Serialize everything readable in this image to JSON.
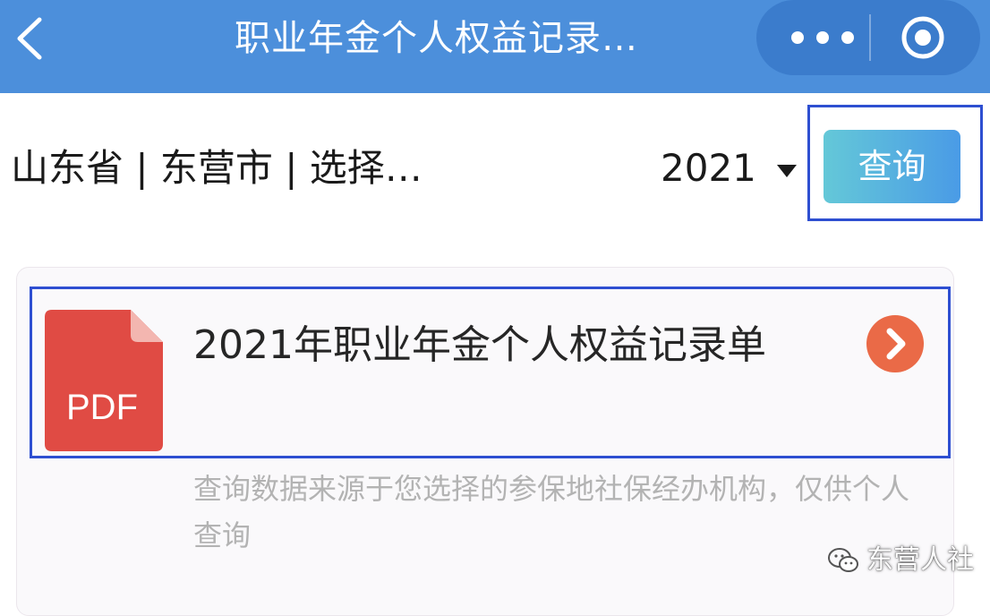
{
  "navbar": {
    "title": "职业年金个人权益记录…",
    "back_icon": "chevron-left-icon",
    "more_icon": "more-dots-icon",
    "close_icon": "target-circle-icon",
    "bg_color": "#4c8fdb"
  },
  "filter": {
    "region_label": "山东省 | 东营市 | 选择…",
    "year_value": "2021",
    "caret_icon": "caret-down-icon",
    "query_button_label": "查询",
    "query_button_colors": [
      "#64c8d8",
      "#4a9be6"
    ]
  },
  "record": {
    "pdf_badge": "PDF",
    "pdf_color": "#e04b44",
    "title": "2021年职业年金个人权益记录单",
    "chevron_icon": "chevron-right-circle-icon",
    "chevron_color": "#ea6a47",
    "note": "查询数据来源于您选择的参保地社保经办机构，仅供个人查询"
  },
  "watermark": {
    "text": "东营人社",
    "icon": "wechat-icon"
  }
}
